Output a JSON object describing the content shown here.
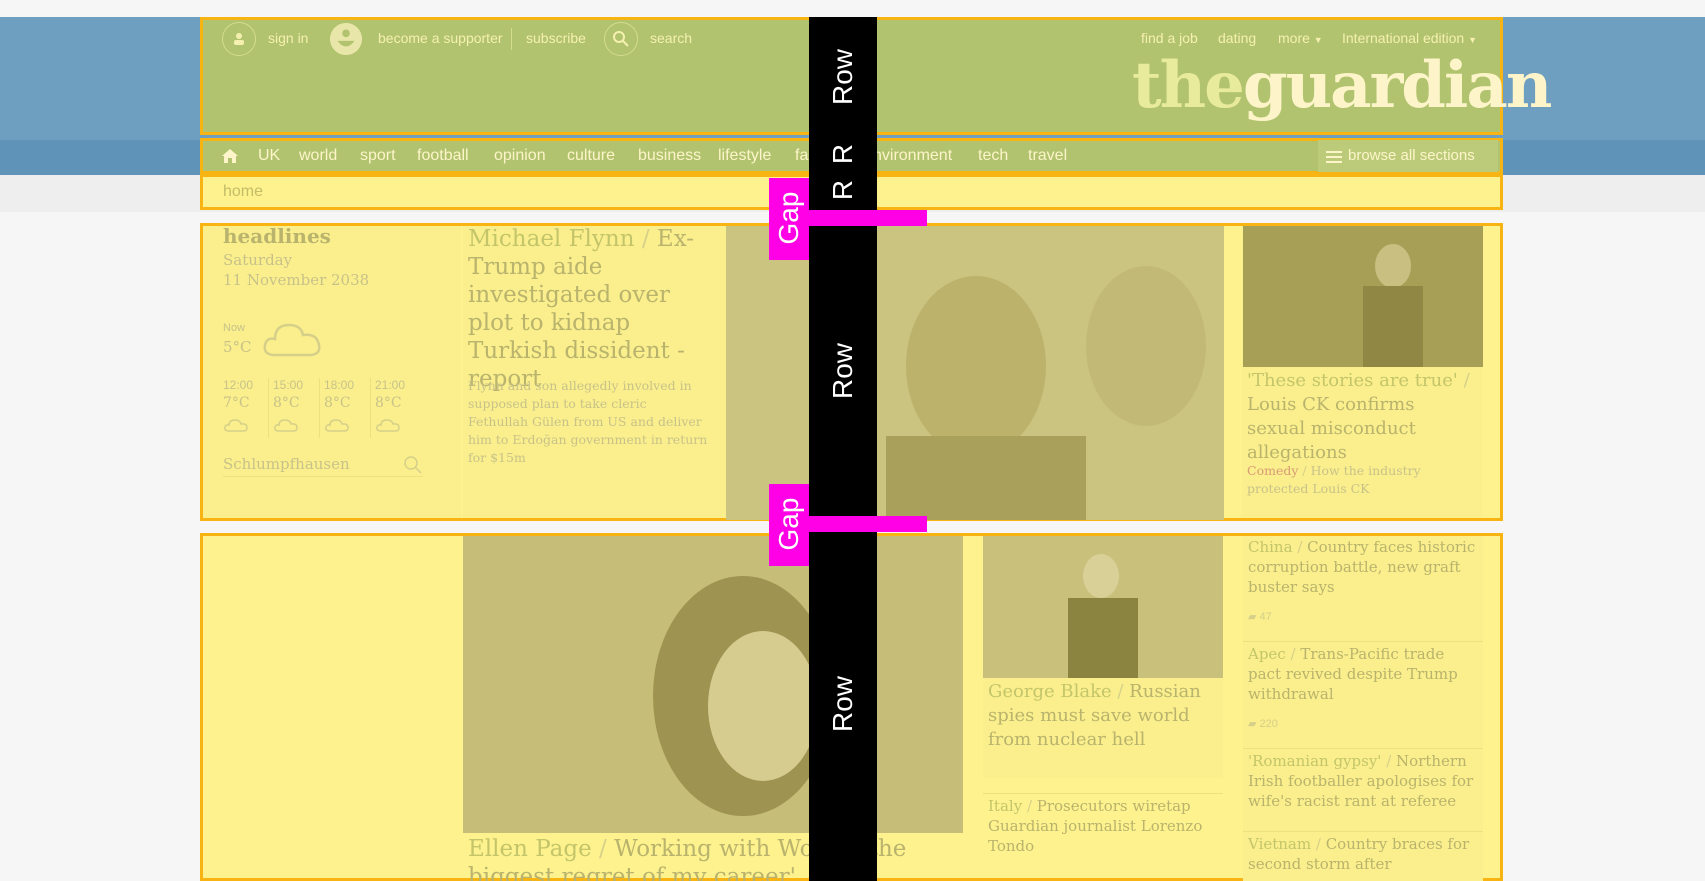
{
  "header": {
    "sign_in": "sign in",
    "become_supporter": "become a supporter",
    "subscribe": "subscribe",
    "search": "search",
    "find_job": "find a job",
    "dating": "dating",
    "more": "more",
    "edition": "International edition",
    "logo_the": "the",
    "logo_guardian": "guardian"
  },
  "nav": {
    "items": [
      "UK",
      "world",
      "sport",
      "football",
      "opinion",
      "culture",
      "business",
      "lifestyle",
      "fa",
      "nvironment",
      "tech",
      "travel"
    ],
    "browse": "browse all sections"
  },
  "breadcrumb": {
    "home": "home"
  },
  "weather": {
    "title": "headlines",
    "day": "Saturday",
    "date": "11 November 2038",
    "now_label": "Now",
    "now_temp": "5°C",
    "forecast": [
      {
        "time": "12:00",
        "temp": "7°C"
      },
      {
        "time": "15:00",
        "temp": "8°C"
      },
      {
        "time": "18:00",
        "temp": "8°C"
      },
      {
        "time": "21:00",
        "temp": "8°C"
      }
    ],
    "location": "Schlumpfhausen"
  },
  "stories": {
    "lead": {
      "kicker": "Michael Flynn",
      "title": "Ex-Trump aide investigated over plot to kidnap Turkish dissident - report",
      "standfirst": "Flynn and son allegedly involved in supposed plan to take cleric Fethullah Gülen from US and deliver him to Erdoğan government in return for $15m"
    },
    "louis": {
      "kicker": "'These stories are true'",
      "title": "Louis CK confirms sexual misconduct allegations",
      "sub_kicker": "Comedy",
      "sub_title": "How the industry protected Louis CK"
    },
    "ellen": {
      "kicker": "Ellen Page",
      "title": "Working with Woody",
      "title_rest": "'the biggest regret of my career'"
    },
    "blake": {
      "kicker": "George Blake",
      "title": "Russian spies must save world from nuclear hell"
    },
    "italy": {
      "kicker": "Italy",
      "title": "Prosecutors wiretap Guardian journalist Lorenzo Tondo"
    },
    "list": [
      {
        "kicker": "China",
        "title": "Country faces historic corruption battle, new graft buster says",
        "comments": "47"
      },
      {
        "kicker": "Apec",
        "title": "Trans-Pacific trade pact revived despite Trump withdrawal",
        "comments": "220"
      },
      {
        "kicker": "'Romanian gypsy'",
        "title": "Northern Irish footballer apologises for wife's racist rant at referee",
        "comments": ""
      },
      {
        "kicker": "Vietnam",
        "title": "Country braces for second storm after devastating",
        "comments": ""
      }
    ]
  },
  "overlay": {
    "row": "Row",
    "r": "R",
    "gap": "Gap"
  }
}
